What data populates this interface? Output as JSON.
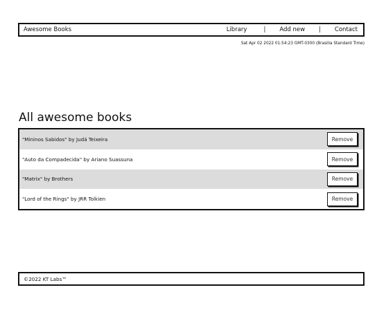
{
  "navbar": {
    "brand": "Awesome Books",
    "links": [
      "Library",
      "Add new",
      "Contact"
    ],
    "separator": "|"
  },
  "datetime": "Sat Apr 02 2022 01:54:23 GMT-0300 (Brasilia Standard Time)",
  "section_title": "All awesome books",
  "books": [
    {
      "label": "\"Mininos Sabidos\" by Judá Teixeira",
      "remove": "Remove"
    },
    {
      "label": "\"Auto da Compadecida\" by Ariano Suassuna",
      "remove": "Remove"
    },
    {
      "label": "\"Matrix\" by Brothers",
      "remove": "Remove"
    },
    {
      "label": "\"Lord of the Rings\" by JRR Tolkien",
      "remove": "Remove"
    }
  ],
  "footer": "©2022 KT Labs™"
}
